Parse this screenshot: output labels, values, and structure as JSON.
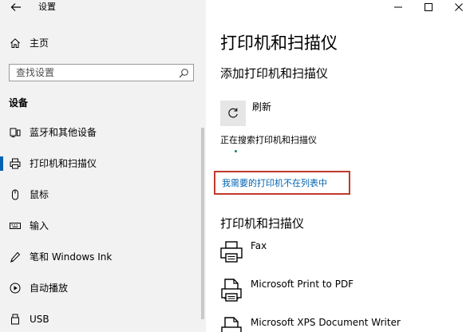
{
  "window": {
    "app_title": "设置",
    "controls": {
      "minimize": "—",
      "maximize": "☐",
      "close": "✕"
    }
  },
  "sidebar": {
    "back_icon": "arrow-left-icon",
    "home": {
      "label": "主页",
      "icon": "home-icon"
    },
    "search": {
      "placeholder": "查找设置",
      "icon": "search-icon"
    },
    "section_heading": "设备",
    "items": [
      {
        "label": "蓝牙和其他设备",
        "icon": "bluetooth-devices-icon",
        "selected": false
      },
      {
        "label": "打印机和扫描仪",
        "icon": "printer-icon",
        "selected": true
      },
      {
        "label": "鼠标",
        "icon": "mouse-icon",
        "selected": false
      },
      {
        "label": "输入",
        "icon": "keyboard-icon",
        "selected": false
      },
      {
        "label": "笔和 Windows Ink",
        "icon": "pen-icon",
        "selected": false
      },
      {
        "label": "自动播放",
        "icon": "autoplay-icon",
        "selected": false
      },
      {
        "label": "USB",
        "icon": "usb-icon",
        "selected": false
      }
    ]
  },
  "main": {
    "title": "打印机和扫描仪",
    "add_section": {
      "heading": "添加打印机和扫描仪",
      "refresh_label": "刷新",
      "searching_text": "正在搜索打印机和扫描仪",
      "missing_link": "我需要的打印机不在列表中",
      "highlight_color": "#c0392b"
    },
    "list_section": {
      "heading": "打印机和扫描仪",
      "printers": [
        {
          "name": "Fax",
          "icon": "fax-printer-icon"
        },
        {
          "name": "Microsoft Print to PDF",
          "icon": "pdf-printer-icon"
        },
        {
          "name": "Microsoft XPS Document Writer",
          "icon": "xps-printer-icon"
        }
      ]
    }
  },
  "colors": {
    "accent": "#0063b1",
    "sidebar_bg": "#f2f2f2",
    "progress": "#0e8a5a"
  }
}
